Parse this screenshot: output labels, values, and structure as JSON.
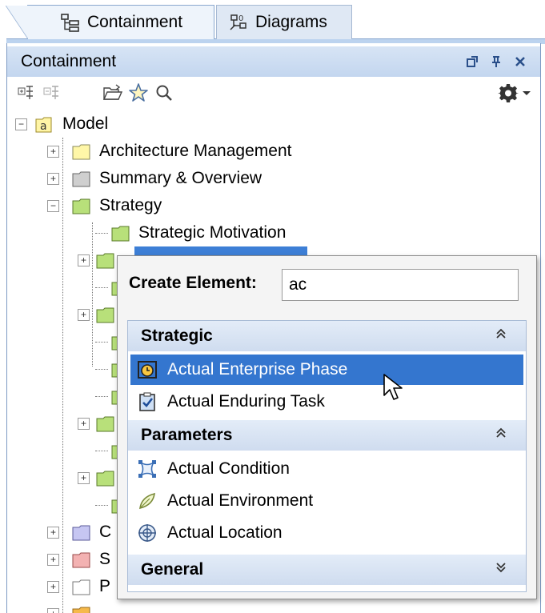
{
  "tabs": [
    {
      "label": "Containment",
      "icon": "containment-icon",
      "active": true
    },
    {
      "label": "Diagrams",
      "icon": "diagrams-icon",
      "active": false
    }
  ],
  "panel": {
    "title": "Containment",
    "controls": [
      "pin-icon",
      "float-icon",
      "close-icon"
    ],
    "toolbar_icons": [
      "expand-tree-icon",
      "collapse-tree-icon",
      "open-folder-icon",
      "star-icon",
      "search-icon",
      "gear-icon",
      "dropdown-arrow-icon"
    ]
  },
  "tree": {
    "root": {
      "label": "Model"
    },
    "items": [
      {
        "label": "Architecture Management",
        "color": "#fff7a8"
      },
      {
        "label": "Summary & Overview",
        "color": "#cfcfcf"
      },
      {
        "label": "Strategy",
        "color": "#b8e07a"
      },
      {
        "label": "Strategic Motivation",
        "color": "#b8e07a"
      },
      {
        "label": "C",
        "color": "#c6c6f2"
      },
      {
        "label": "S",
        "color": "#f3b2b2"
      },
      {
        "label": "P",
        "color": "#ffffff"
      }
    ]
  },
  "popup": {
    "label": "Create Element:",
    "input_value": "ac",
    "groups": [
      {
        "label": "Strategic",
        "chevron": "»",
        "items": [
          {
            "label": "Actual Enterprise Phase",
            "icon": "enterprise-phase-icon",
            "selected": true
          },
          {
            "label": "Actual Enduring Task",
            "icon": "enduring-task-icon",
            "selected": false
          }
        ]
      },
      {
        "label": "Parameters",
        "chevron": "»",
        "items": [
          {
            "label": "Actual Condition",
            "icon": "condition-icon",
            "selected": false
          },
          {
            "label": "Actual Environment",
            "icon": "environment-icon",
            "selected": false
          },
          {
            "label": "Actual Location",
            "icon": "location-icon",
            "selected": false
          }
        ]
      },
      {
        "label": "General",
        "chevron": "»",
        "items": []
      }
    ]
  },
  "colors": {
    "accent": "#3476cf",
    "group_header": "#d6e2f3",
    "titlebar": "#c9dbf1"
  }
}
